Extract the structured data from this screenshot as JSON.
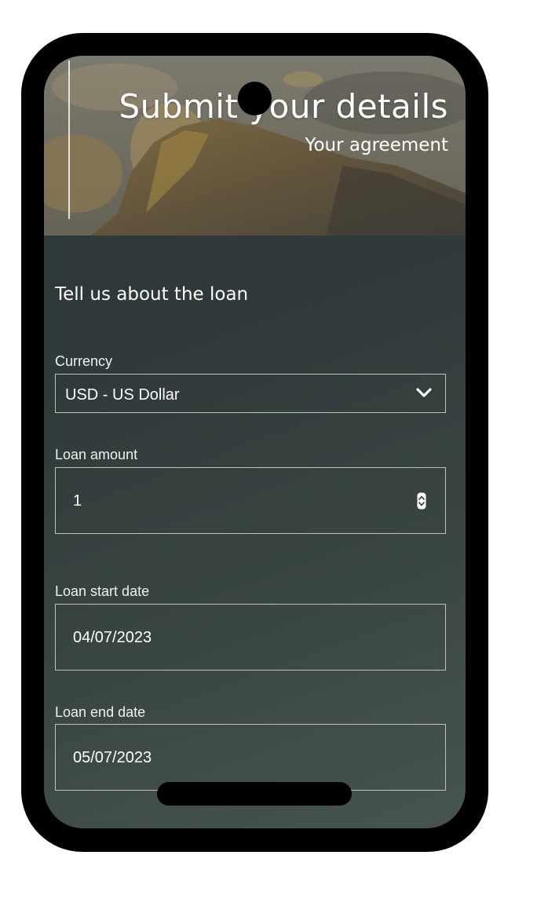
{
  "hero": {
    "title": "Submit your details",
    "subtitle": "Your agreement"
  },
  "form": {
    "section_title": "Tell us about the loan",
    "currency": {
      "label": "Currency",
      "selected": "USD - US Dollar",
      "icon": "chevron-down-icon"
    },
    "loan_amount": {
      "label": "Loan amount",
      "value": "1",
      "icon": "spinner-arrows-icon"
    },
    "loan_start_date": {
      "label": "Loan start date",
      "value": "04/07/2023"
    },
    "loan_end_date": {
      "label": "Loan end date",
      "value": "05/07/2023"
    }
  },
  "colors": {
    "field_border": "#c9bfae",
    "background_dark": "#2c3436",
    "text": "#ffffff"
  }
}
